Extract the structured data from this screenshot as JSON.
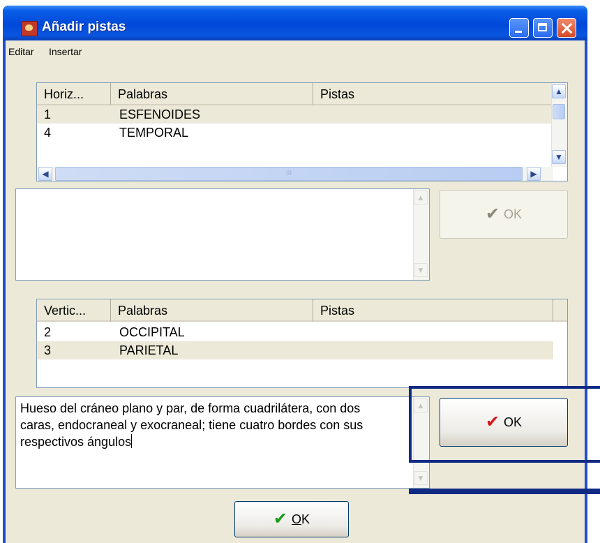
{
  "window": {
    "title": "Añadir pistas"
  },
  "menu": {
    "items": [
      "Editar",
      "Insertar"
    ]
  },
  "horizontal": {
    "columns": [
      "Horiz...",
      "Palabras",
      "Pistas"
    ],
    "rows": [
      {
        "num": "1",
        "word": "ESFENOIDES",
        "clue": ""
      },
      {
        "num": "4",
        "word": "TEMPORAL",
        "clue": ""
      }
    ],
    "scroll_mark": "III",
    "memo_text": "",
    "ok_label": "OK"
  },
  "vertical": {
    "columns": [
      "Vertic...",
      "Palabras",
      "Pistas"
    ],
    "rows": [
      {
        "num": "2",
        "word": "OCCIPITAL",
        "clue": ""
      },
      {
        "num": "3",
        "word": "PARIETAL",
        "clue": ""
      }
    ],
    "memo_text": "Hueso del cráneo plano y par, de forma cuadrilátera, con dos caras, endocraneal y exocraneal; tiene cuatro bordes con sus respectivos ángulos",
    "ok_label": "OK"
  },
  "footer": {
    "ok_label": "OK",
    "ok_mnemonic": "O",
    "ok_rest": "K"
  },
  "colors": {
    "check_green": "#1a9b1a",
    "check_red": "#d4161b",
    "check_disabled": "#8a8778"
  },
  "icons": {
    "app": "crossword-app-icon",
    "minimize": "minimize-icon",
    "maximize": "maximize-icon",
    "close": "close-icon"
  }
}
